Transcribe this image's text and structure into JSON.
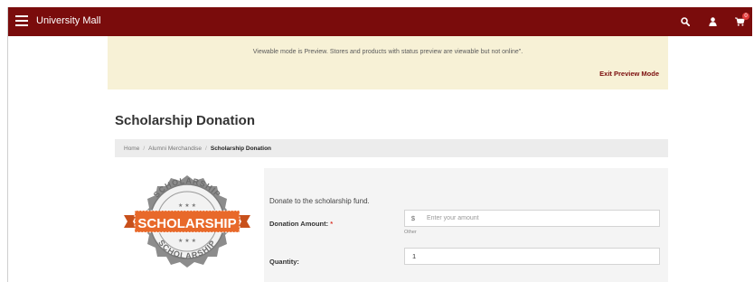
{
  "header": {
    "brand": "University Mall",
    "icons": [
      "menu-icon",
      "search-icon",
      "user-icon",
      "cart-icon"
    ],
    "cart_count": "0",
    "bar_color": "#7a0c0c"
  },
  "preview": {
    "message": "Viewable mode is Preview. Stores and products with status preview are viewable but not online\".",
    "exit_label": "Exit Preview Mode"
  },
  "page": {
    "title": "Scholarship Donation"
  },
  "breadcrumb": {
    "items": [
      "Home",
      "Alumni Merchandise",
      "Scholarship Donation"
    ]
  },
  "product": {
    "badge_alt": "SCHOLARSHIP",
    "intro": "Donate to the scholarship fund.",
    "amount_label": "Donation Amount:",
    "required_mark": "*",
    "currency_symbol": "$",
    "amount_placeholder": "Enter your amount",
    "amount_hint": "Other",
    "quantity_label": "Quantity:",
    "quantity_value": "1"
  }
}
